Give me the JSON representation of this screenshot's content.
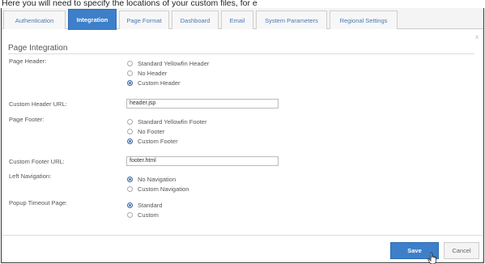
{
  "caption": "Here you will need to specify the locations of your custom files, for e",
  "tabs": [
    {
      "label": "Authentication",
      "active": false
    },
    {
      "label": "Integration",
      "active": true
    },
    {
      "label": "Page Format",
      "active": false
    },
    {
      "label": "Dashboard",
      "active": false
    },
    {
      "label": "Email",
      "active": false
    },
    {
      "label": "System Parameters",
      "active": false
    },
    {
      "label": "Regional Settings",
      "active": false
    }
  ],
  "close_glyph": "x",
  "section_title": "Page Integration",
  "page_header": {
    "label": "Page Header:",
    "options": [
      "Standard Yellowfin Header",
      "No Header",
      "Custom Header"
    ],
    "selected": 2
  },
  "custom_header_url": {
    "label": "Custom Header URL:",
    "value": "header.jsp"
  },
  "page_footer": {
    "label": "Page Footer:",
    "options": [
      "Standard Yellowfin Footer",
      "No Footer",
      "Custom Footer"
    ],
    "selected": 2
  },
  "custom_footer_url": {
    "label": "Custom Footer URL:",
    "value": "footer.html"
  },
  "left_navigation": {
    "label": "Left Navigation:",
    "options": [
      "No Navigation",
      "Custom Navigation"
    ],
    "selected": 0
  },
  "popup_timeout": {
    "label": "Popup Timeout Page:",
    "options": [
      "Standard",
      "Custom"
    ],
    "selected": 0
  },
  "buttons": {
    "save": "Save",
    "cancel": "Cancel"
  },
  "colors": {
    "accent": "#3d7fc9",
    "tab_text": "#4a78b5"
  }
}
